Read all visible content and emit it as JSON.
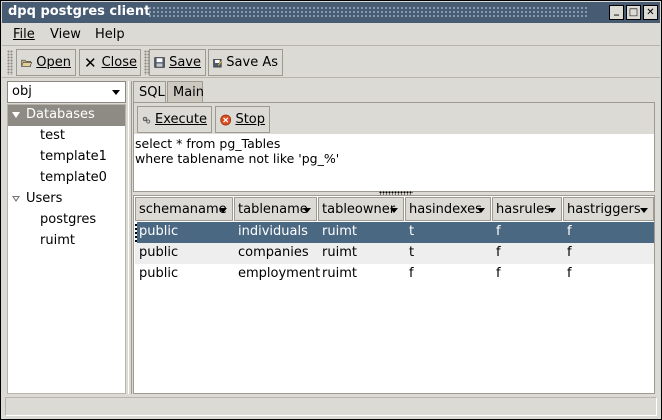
{
  "window": {
    "title": "dpq postgres client",
    "controls": {
      "minimize": "_",
      "maximize": "□",
      "close": "✕"
    }
  },
  "menubar": {
    "items": [
      {
        "label": "File"
      },
      {
        "label": "View"
      },
      {
        "label": "Help"
      }
    ]
  },
  "toolbar": {
    "open_label": "Open",
    "close_label": "Close",
    "save_label": "Save",
    "save_as_label": "Save As"
  },
  "left": {
    "connection_select": "obj",
    "tree": {
      "databases_label": "Databases",
      "databases": [
        "test",
        "template1",
        "template0"
      ],
      "users_label": "Users",
      "users": [
        "postgres",
        "ruimt"
      ]
    }
  },
  "tabs": [
    {
      "label": "SQL"
    },
    {
      "label": "Main"
    }
  ],
  "sql": {
    "execute_label": "Execute",
    "stop_label": "Stop",
    "query_lines": [
      "select * from pg_Tables",
      "where tablename not like 'pg_%'"
    ]
  },
  "results": {
    "columns": [
      "schemaname",
      "tablename",
      "tableowner",
      "hasindexes",
      "hasrules",
      "hastriggers"
    ],
    "rows": [
      [
        "public",
        "individuals",
        "ruimt",
        "t",
        "f",
        "f"
      ],
      [
        "public",
        "companies",
        "ruimt",
        "t",
        "f",
        "f"
      ],
      [
        "public",
        "employment",
        "ruimt",
        "f",
        "f",
        "f"
      ]
    ],
    "selected_row_index": 0
  },
  "colors": {
    "titlebar": "#475b72",
    "selection": "#4b6883",
    "tree_selection": "#8e8b84",
    "stop_icon": "#e0491c"
  }
}
